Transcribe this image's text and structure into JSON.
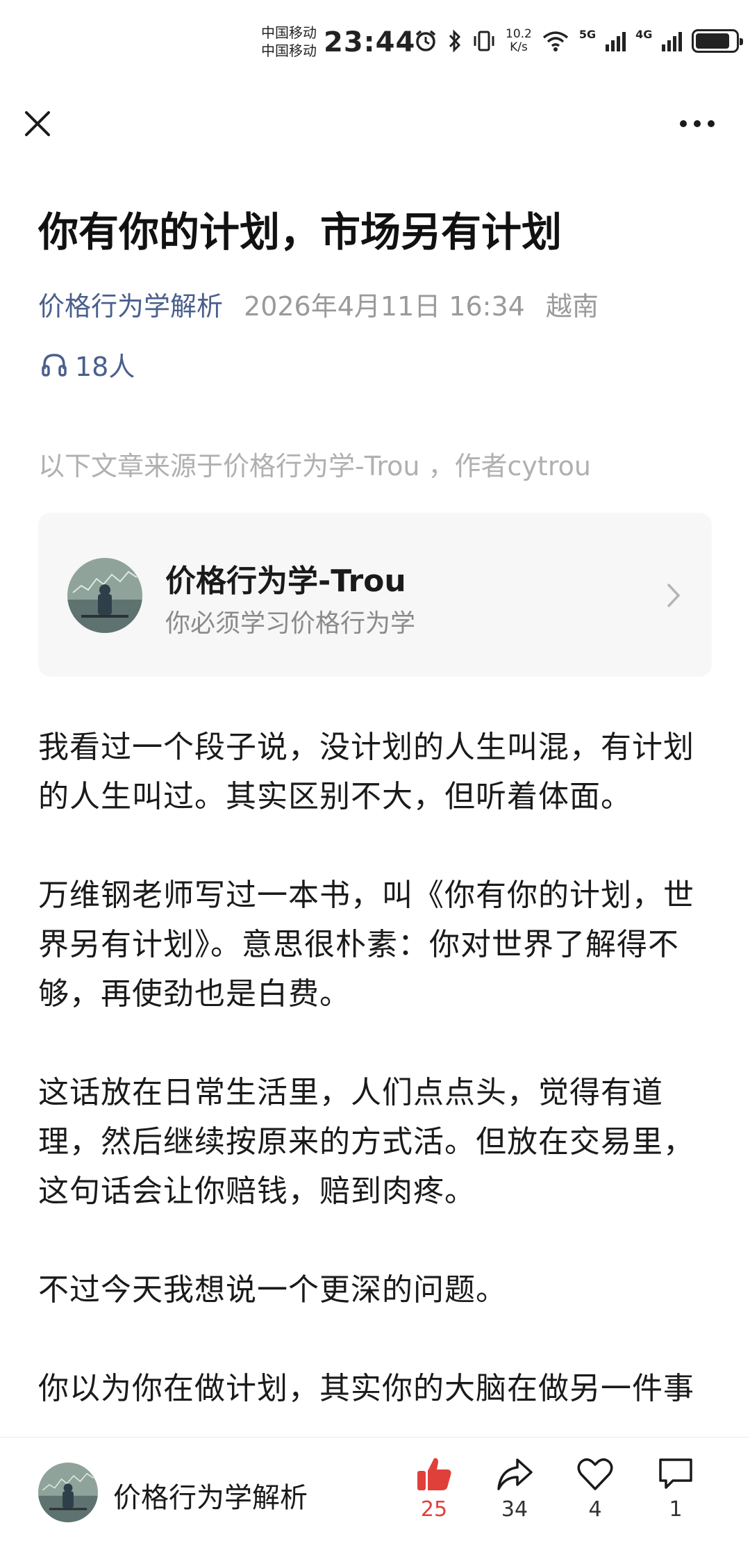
{
  "status_bar": {
    "carrier_1": "中国移动",
    "carrier_2": "中国移动",
    "time": "23:44",
    "speed_value": "10.2",
    "speed_unit": "K/s",
    "net_1": "5G",
    "net_2": "4G"
  },
  "article": {
    "title": "你有你的计划，市场另有计划",
    "author": "价格行为学解析",
    "date": "2026年4月11日 16:34",
    "location": "越南",
    "listeners": "18人",
    "source_note": "以下文章来源于价格行为学-Trou ，作者cytrou",
    "paragraphs": [
      "我看过一个段子说，没计划的人生叫混，有计划的人生叫过。其实区别不大，但听着体面。",
      "万维钢老师写过一本书，叫《你有你的计划，世界另有计划》。意思很朴素：你对世界了解得不够，再使劲也是白费。",
      "这话放在日常生活里，人们点点头，觉得有道理，然后继续按原来的方式活。但放在交易里，这句话会让你赔钱，赔到肉疼。",
      "不过今天我想说一个更深的问题。",
      "你以为你在做计划，其实你的大脑在做另一件事"
    ]
  },
  "source_card": {
    "name": "价格行为学-Trou",
    "description": "你必须学习价格行为学"
  },
  "bottom_bar": {
    "account_name": "价格行为学解析",
    "like_count": "25",
    "share_count": "34",
    "favorite_count": "4",
    "comment_count": "1"
  },
  "colors": {
    "accent_blue": "#4a5f8c",
    "like_red": "#e0403a",
    "muted_gray": "#9a9a9a"
  }
}
